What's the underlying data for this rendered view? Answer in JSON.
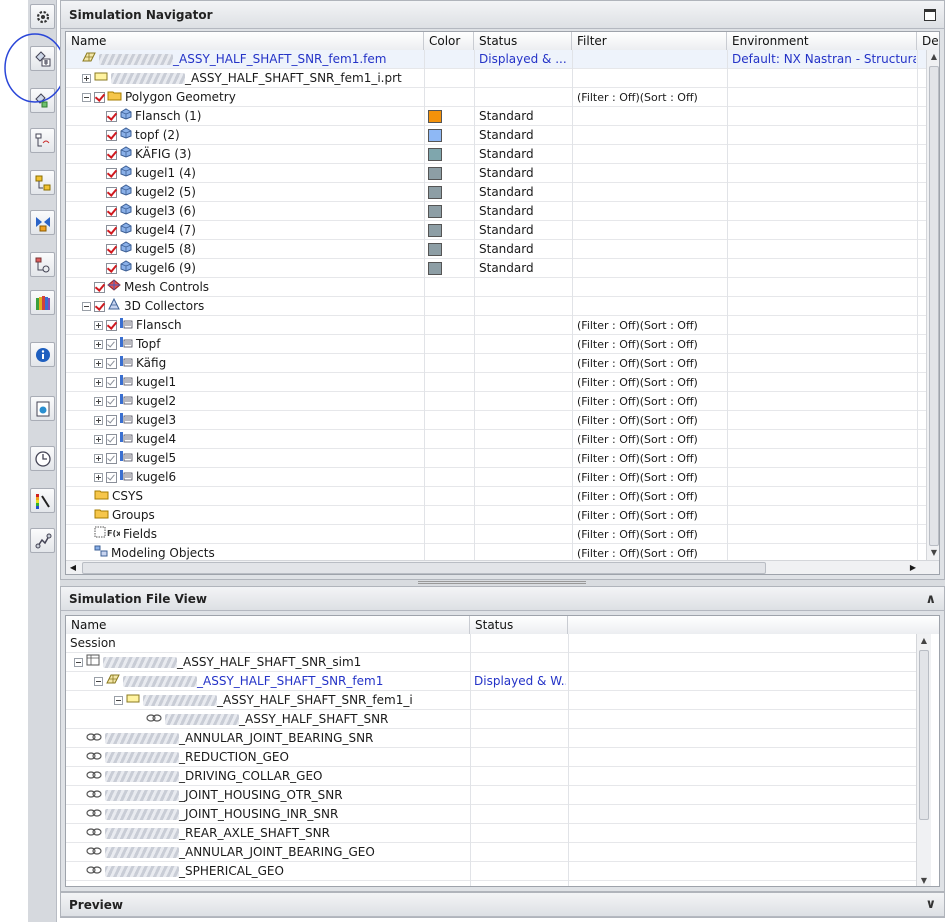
{
  "resource_bar": {
    "icons": [
      "gear-icon",
      "simulation-navigator-icon",
      "assembly-navigator-icon",
      "part-navigator-icon",
      "constraint-navigator-icon",
      "reuse-library-icon",
      "system-materials-icon",
      "roles-icon",
      "info-icon",
      "web-browser-icon",
      "history-icon",
      "color-palette-icon",
      "process-studio-icon"
    ]
  },
  "nav": {
    "title": "Simulation Navigator",
    "columns": [
      "Name",
      "Color",
      "Status",
      "Filter",
      "Environment",
      "De"
    ],
    "rows": [
      {
        "level": 0,
        "expander": "none",
        "check": "none",
        "icon": "fem",
        "blurred": true,
        "name": "_ASSY_HALF_SHAFT_SNR_fem1.fem",
        "status": "Displayed & ...",
        "filter": "",
        "env": "Default: NX Nastran - Structural",
        "blue": true,
        "selected": true
      },
      {
        "level": 1,
        "expander": "plus",
        "check": "none",
        "icon": "prt",
        "blurred": true,
        "name": "_ASSY_HALF_SHAFT_SNR_fem1_i.prt",
        "status": "",
        "filter": "",
        "env": "",
        "blue": false
      },
      {
        "level": 1,
        "expander": "minus",
        "check": "on",
        "icon": "folder",
        "blurred": false,
        "name": "Polygon Geometry",
        "status": "",
        "filter": "(Filter : Off)(Sort : Off)",
        "env": ""
      },
      {
        "level": 2,
        "expander": "none",
        "check": "on",
        "icon": "body",
        "name": "Flansch (1)",
        "color": "#f4920a",
        "status": "Standard",
        "filter": "",
        "env": ""
      },
      {
        "level": 2,
        "expander": "none",
        "check": "on",
        "icon": "body",
        "name": "topf (2)",
        "color": "#8eb8f5",
        "status": "Standard",
        "filter": "",
        "env": ""
      },
      {
        "level": 2,
        "expander": "none",
        "check": "on",
        "icon": "body",
        "name": "KÄFIG (3)",
        "color": "#7fa6ad",
        "status": "Standard",
        "filter": "",
        "env": ""
      },
      {
        "level": 2,
        "expander": "none",
        "check": "on",
        "icon": "body",
        "name": "kugel1 (4)",
        "color": "#8d9ea5",
        "status": "Standard",
        "filter": "",
        "env": ""
      },
      {
        "level": 2,
        "expander": "none",
        "check": "on",
        "icon": "body",
        "name": "kugel2 (5)",
        "color": "#8d9ea5",
        "status": "Standard",
        "filter": "",
        "env": ""
      },
      {
        "level": 2,
        "expander": "none",
        "check": "on",
        "icon": "body",
        "name": "kugel3 (6)",
        "color": "#8d9ea5",
        "status": "Standard",
        "filter": "",
        "env": ""
      },
      {
        "level": 2,
        "expander": "none",
        "check": "on",
        "icon": "body",
        "name": "kugel4 (7)",
        "color": "#8d9ea5",
        "status": "Standard",
        "filter": "",
        "env": ""
      },
      {
        "level": 2,
        "expander": "none",
        "check": "on",
        "icon": "body",
        "name": "kugel5 (8)",
        "color": "#8d9ea5",
        "status": "Standard",
        "filter": "",
        "env": ""
      },
      {
        "level": 2,
        "expander": "none",
        "check": "on",
        "icon": "body",
        "name": "kugel6 (9)",
        "color": "#8d9ea5",
        "status": "Standard",
        "filter": "",
        "env": ""
      },
      {
        "level": 1,
        "expander": "none",
        "check": "on",
        "icon": "mesh",
        "name": "Mesh Controls",
        "status": "",
        "filter": "",
        "env": ""
      },
      {
        "level": 1,
        "expander": "minus",
        "check": "on",
        "icon": "collector3d",
        "name": "3D Collectors",
        "status": "",
        "filter": "",
        "env": ""
      },
      {
        "level": 2,
        "expander": "plus",
        "check": "on",
        "icon": "collector",
        "name": "Flansch",
        "status": "",
        "filter": "(Filter : Off)(Sort : Off)",
        "env": ""
      },
      {
        "level": 2,
        "expander": "plus",
        "check": "gray",
        "icon": "collector",
        "name": "Topf",
        "status": "",
        "filter": "(Filter : Off)(Sort : Off)",
        "env": ""
      },
      {
        "level": 2,
        "expander": "plus",
        "check": "gray",
        "icon": "collector",
        "name": "Käfig",
        "status": "",
        "filter": "(Filter : Off)(Sort : Off)",
        "env": ""
      },
      {
        "level": 2,
        "expander": "plus",
        "check": "gray",
        "icon": "collector",
        "name": "kugel1",
        "status": "",
        "filter": "(Filter : Off)(Sort : Off)",
        "env": ""
      },
      {
        "level": 2,
        "expander": "plus",
        "check": "gray",
        "icon": "collector",
        "name": "kugel2",
        "status": "",
        "filter": "(Filter : Off)(Sort : Off)",
        "env": ""
      },
      {
        "level": 2,
        "expander": "plus",
        "check": "gray",
        "icon": "collector",
        "name": "kugel3",
        "status": "",
        "filter": "(Filter : Off)(Sort : Off)",
        "env": ""
      },
      {
        "level": 2,
        "expander": "plus",
        "check": "gray",
        "icon": "collector",
        "name": "kugel4",
        "status": "",
        "filter": "(Filter : Off)(Sort : Off)",
        "env": ""
      },
      {
        "level": 2,
        "expander": "plus",
        "check": "gray",
        "icon": "collector",
        "name": "kugel5",
        "status": "",
        "filter": "(Filter : Off)(Sort : Off)",
        "env": ""
      },
      {
        "level": 2,
        "expander": "plus",
        "check": "gray",
        "icon": "collector",
        "name": "kugel6",
        "status": "",
        "filter": "(Filter : Off)(Sort : Off)",
        "env": ""
      },
      {
        "level": 1,
        "expander": "none",
        "check": "none",
        "icon": "folder",
        "name": "CSYS",
        "status": "",
        "filter": "(Filter : Off)(Sort : Off)",
        "env": ""
      },
      {
        "level": 1,
        "expander": "none",
        "check": "none",
        "icon": "folder",
        "name": "Groups",
        "status": "",
        "filter": "(Filter : Off)(Sort : Off)",
        "env": ""
      },
      {
        "level": 1,
        "expander": "none",
        "check": "none",
        "icon": "fields",
        "name": "Fields",
        "status": "",
        "filter": "(Filter : Off)(Sort : Off)",
        "env": ""
      },
      {
        "level": 1,
        "expander": "none",
        "check": "none",
        "icon": "modeling",
        "name": "Modeling Objects",
        "status": "",
        "filter": "(Filter : Off)(Sort : Off)",
        "env": ""
      }
    ]
  },
  "file_view": {
    "title": "Simulation File View",
    "columns": [
      "Name",
      "Status"
    ],
    "rows": [
      {
        "level": 0,
        "icon": "none",
        "blurred": false,
        "name": "Session",
        "status": ""
      },
      {
        "level": 0,
        "expander": "minus",
        "icon": "sim",
        "blurred": true,
        "name": "_ASSY_HALF_SHAFT_SNR_sim1",
        "status": ""
      },
      {
        "level": 1,
        "expander": "minus",
        "icon": "fem",
        "blurred": true,
        "name": "_ASSY_HALF_SHAFT_SNR_fem1",
        "status": "Displayed & W...",
        "blue": true
      },
      {
        "level": 2,
        "expander": "minus",
        "icon": "prt",
        "blurred": true,
        "name": "_ASSY_HALF_SHAFT_SNR_fem1_i",
        "status": ""
      },
      {
        "level": 3,
        "icon": "link",
        "blurred": true,
        "name": "_ASSY_HALF_SHAFT_SNR",
        "status": ""
      },
      {
        "level": 0,
        "icon": "link",
        "blurred": true,
        "name": "_ANNULAR_JOINT_BEARING_SNR",
        "status": ""
      },
      {
        "level": 0,
        "icon": "link",
        "blurred": true,
        "name": "_REDUCTION_GEO",
        "status": ""
      },
      {
        "level": 0,
        "icon": "link",
        "blurred": true,
        "name": "_DRIVING_COLLAR_GEO",
        "status": ""
      },
      {
        "level": 0,
        "icon": "link",
        "blurred": true,
        "name": "_JOINT_HOUSING_OTR_SNR",
        "status": ""
      },
      {
        "level": 0,
        "icon": "link",
        "blurred": true,
        "name": "_JOINT_HOUSING_INR_SNR",
        "status": ""
      },
      {
        "level": 0,
        "icon": "link",
        "blurred": true,
        "name": "_REAR_AXLE_SHAFT_SNR",
        "status": ""
      },
      {
        "level": 0,
        "icon": "link",
        "blurred": true,
        "name": "_ANNULAR_JOINT_BEARING_GEO",
        "status": ""
      },
      {
        "level": 0,
        "icon": "link",
        "blurred": true,
        "name": "_SPHERICAL_GEO",
        "status": ""
      }
    ]
  },
  "preview": {
    "title": "Preview"
  }
}
